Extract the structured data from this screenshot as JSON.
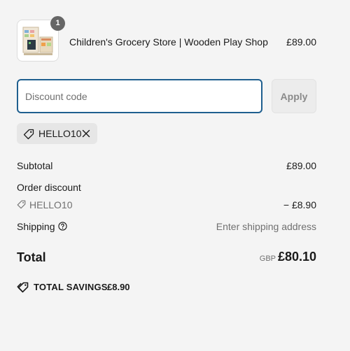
{
  "cart": {
    "item": {
      "quantity": "1",
      "name": "Children's Grocery Store | Wooden Play Shop",
      "price": "£89.00"
    }
  },
  "discount_form": {
    "placeholder": "Discount code",
    "value": "",
    "apply_label": "Apply",
    "applied_code": "HELLO10"
  },
  "summary": {
    "subtotal_label": "Subtotal",
    "subtotal_value": "£89.00",
    "order_discount_label": "Order discount",
    "discount_code": "HELLO10",
    "discount_value": "− £8.90",
    "shipping_label": "Shipping",
    "shipping_value": "Enter shipping address",
    "total_label": "Total",
    "currency": "GBP",
    "total_value": "£80.10",
    "savings_label": "TOTAL SAVINGS",
    "savings_value": "£8.90"
  },
  "icons": {
    "tag": "tag-icon",
    "remove": "close-icon",
    "info": "question-circle-icon",
    "savings": "tags-icon"
  },
  "colors": {
    "focus_border": "#1f5f8f",
    "background": "#f4f4f4",
    "badge": "#666666"
  }
}
